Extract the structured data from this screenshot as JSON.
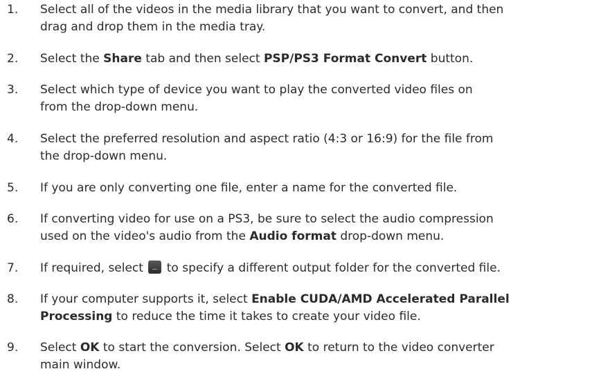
{
  "steps": [
    {
      "number": "1.",
      "line1": "Select all of the videos in the media library that you want to convert, and then",
      "line2": "drag and drop them in the media tray."
    },
    {
      "number": "2.",
      "pre": "Select the ",
      "bold1": "Share",
      "mid": " tab and then select ",
      "bold2": "PSP/PS3 Format Convert",
      "post": " button."
    },
    {
      "number": "3.",
      "line1": "Select which type of device you want to play the converted video files on",
      "line2": "from the drop-down menu."
    },
    {
      "number": "4.",
      "line1": "Select the preferred resolution and aspect ratio (4:3 or 16:9) for the file from",
      "line2": "the drop-down menu."
    },
    {
      "number": "5.",
      "line1": "If you are only converting one file, enter a name for the converted file."
    },
    {
      "number": "6.",
      "line1": "If converting video for use on a PS3, be sure to select the audio compression",
      "line2_pre": "used on the video's audio from the ",
      "line2_bold": "Audio format",
      "line2_post": " drop-down menu."
    },
    {
      "number": "7.",
      "pre": "If required, select ",
      "icon": "folder-browse-icon",
      "post": " to specify a different output folder for the converted file."
    },
    {
      "number": "8.",
      "line1_pre": "If your computer supports it, select ",
      "line1_bold": "Enable CUDA/AMD Accelerated Parallel",
      "line2_bold": "Processing",
      "line2_post": " to reduce the time it takes to create your video file."
    },
    {
      "number": "9.",
      "pre1": "Select ",
      "bold1": "OK",
      "mid": " to start the conversion. Select ",
      "bold2": "OK",
      "post": " to return to the video converter",
      "line2": "main window."
    }
  ]
}
